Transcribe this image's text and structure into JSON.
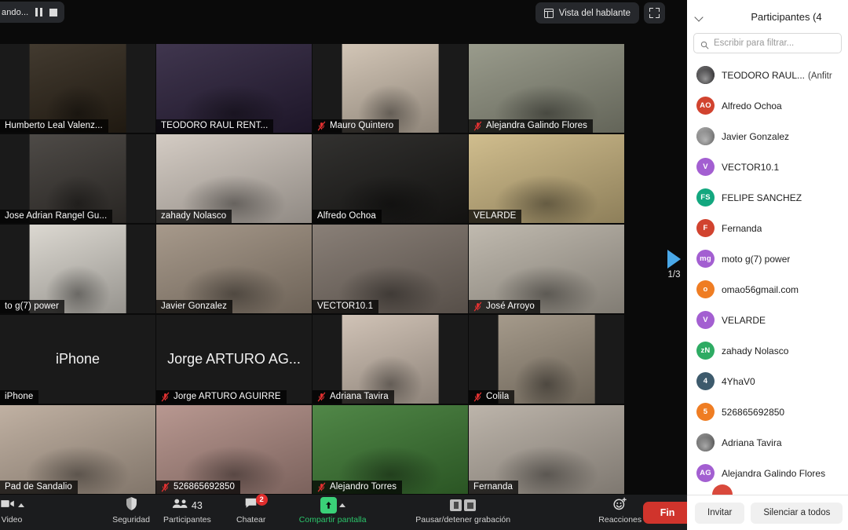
{
  "meeting": {
    "recording_label": "ando...",
    "view_button": "Vista del hablante",
    "page_indicator": "1/3"
  },
  "grid": {
    "tiles": [
      {
        "name": "Humberto Leal Valenz...",
        "muted": false,
        "video": true,
        "active": false,
        "inner": "narrow",
        "bg": "#2d2418"
      },
      {
        "name": "TEODORO RAUL RENT...",
        "muted": false,
        "video": true,
        "active": false,
        "inner": "full",
        "bg": "#2a1f3a"
      },
      {
        "name": "Mauro Quintero",
        "muted": true,
        "video": true,
        "active": false,
        "inner": "narrow",
        "bg": "#cdbfae"
      },
      {
        "name": "Alejandra Galindo Flores",
        "muted": true,
        "video": true,
        "active": false,
        "inner": "full",
        "bg": "#8e907f"
      },
      {
        "name": "Jose Adrian Rangel Gu...",
        "muted": false,
        "video": true,
        "active": false,
        "inner": "narrow",
        "bg": "#3a3632"
      },
      {
        "name": "zahady Nolasco",
        "muted": false,
        "video": true,
        "active": false,
        "inner": "full",
        "bg": "#cfc6bd"
      },
      {
        "name": "Alfredo Ochoa",
        "muted": false,
        "video": true,
        "active": true,
        "inner": "full",
        "bg": "#1b1a18"
      },
      {
        "name": "VELARDE",
        "muted": false,
        "video": true,
        "active": false,
        "inner": "full",
        "bg": "#cbb681"
      },
      {
        "name": "to g(7) power",
        "muted": false,
        "video": true,
        "active": false,
        "inner": "narrow",
        "bg": "#d8d4cc"
      },
      {
        "name": "Javier Gonzalez",
        "muted": false,
        "video": true,
        "active": false,
        "inner": "full",
        "bg": "#9d8e7e"
      },
      {
        "name": "VECTOR10.1",
        "muted": false,
        "video": true,
        "active": false,
        "inner": "full",
        "bg": "#7c7168"
      },
      {
        "name": "José Arroyo",
        "muted": true,
        "video": true,
        "active": false,
        "inner": "full",
        "bg": "#b9b2a6"
      },
      {
        "name": "iPhone",
        "muted": false,
        "video": false,
        "active": false,
        "inner": "full",
        "bg": "#242424"
      },
      {
        "name": "Jorge ARTURO AGUIRRE",
        "display": "Jorge ARTURO AG...",
        "muted": true,
        "video": false,
        "active": false,
        "inner": "full",
        "bg": "#242424"
      },
      {
        "name": "Adriana Tavira",
        "muted": true,
        "video": true,
        "active": false,
        "inner": "narrow",
        "bg": "#cbbcae"
      },
      {
        "name": "Colila",
        "muted": true,
        "video": true,
        "active": false,
        "inner": "narrow",
        "bg": "#9b8f7e"
      },
      {
        "name": "Pad de Sandalio",
        "muted": false,
        "video": true,
        "active": false,
        "inner": "full",
        "bg": "#b9a898"
      },
      {
        "name": "526865692850",
        "muted": true,
        "video": true,
        "active": false,
        "inner": "full",
        "bg": "#b08c84"
      },
      {
        "name": "Alejandro Torres",
        "muted": true,
        "video": true,
        "active": false,
        "inner": "full",
        "bg": "#3d7a33"
      },
      {
        "name": "Fernanda",
        "muted": false,
        "video": true,
        "active": false,
        "inner": "full",
        "bg": "#b5aca1"
      }
    ]
  },
  "toolbar": {
    "items": [
      {
        "label": "Video",
        "icon": "video-icon",
        "caret": true,
        "green": false
      },
      {
        "label": "Seguridad",
        "icon": "shield-icon",
        "caret": false,
        "green": false
      },
      {
        "label": "Participantes",
        "icon": "participants-icon",
        "count": "43",
        "caret": false,
        "green": false
      },
      {
        "label": "Chatear",
        "icon": "chat-icon",
        "badge": "2",
        "caret": false,
        "green": false
      },
      {
        "label": "Compartir pantalla",
        "icon": "share-screen-icon",
        "caret": true,
        "green": true
      },
      {
        "label": "Pausar/detener grabación",
        "icon": "pause-stop-recording-icon",
        "caret": false,
        "green": false
      },
      {
        "label": "Reacciones",
        "icon": "reactions-icon",
        "caret": false,
        "green": false
      }
    ],
    "end_button": "Fin"
  },
  "panel": {
    "title": "Participantes (4",
    "search_placeholder": "Escribir para filtrar...",
    "search_value": "",
    "invite_button": "Invitar",
    "mute_all_button": "Silenciar a todos",
    "participants": [
      {
        "name": "TEODORO RAUL...",
        "host": "(Anfitr",
        "initials": "",
        "color": "#3b3a3c",
        "photo": true
      },
      {
        "name": "Alfredo Ochoa",
        "host": "",
        "initials": "AO",
        "color": "#d1432f",
        "photo": false
      },
      {
        "name": "Javier Gonzalez",
        "host": "",
        "initials": "",
        "color": "#8d8d8d",
        "photo": true
      },
      {
        "name": "VECTOR10.1",
        "host": "",
        "initials": "V",
        "color": "#a35fd1",
        "photo": false
      },
      {
        "name": "FELIPE SANCHEZ",
        "host": "",
        "initials": "FS",
        "color": "#13a77f",
        "photo": false
      },
      {
        "name": "Fernanda",
        "host": "",
        "initials": "F",
        "color": "#d1432f",
        "photo": false
      },
      {
        "name": "moto g(7) power",
        "host": "",
        "initials": "mg",
        "color": "#a35fd1",
        "photo": false
      },
      {
        "name": "omao56gmail.com",
        "host": "",
        "initials": "o",
        "color": "#ef7d23",
        "photo": false
      },
      {
        "name": "VELARDE",
        "host": "",
        "initials": "V",
        "color": "#a35fd1",
        "photo": false
      },
      {
        "name": "zahady Nolasco",
        "host": "",
        "initials": "zN",
        "color": "#2eab63",
        "photo": false
      },
      {
        "name": "4YhaV0",
        "host": "",
        "initials": "4",
        "color": "#3d5a6c",
        "photo": false
      },
      {
        "name": "526865692850",
        "host": "",
        "initials": "5",
        "color": "#ef7d23",
        "photo": false
      },
      {
        "name": "Adriana Tavira",
        "host": "",
        "initials": "",
        "color": "#6e6e6e",
        "photo": true
      },
      {
        "name": "Alejandra Galindo Flores",
        "host": "",
        "initials": "AG",
        "color": "#a35fd1",
        "photo": false
      }
    ]
  },
  "colors": {
    "accent_green": "#3ad178",
    "active_speaker": "#b4e06a",
    "end_red": "#d0342c",
    "page_arrow": "#4aa8e8",
    "badge_red": "#e02d2d"
  }
}
